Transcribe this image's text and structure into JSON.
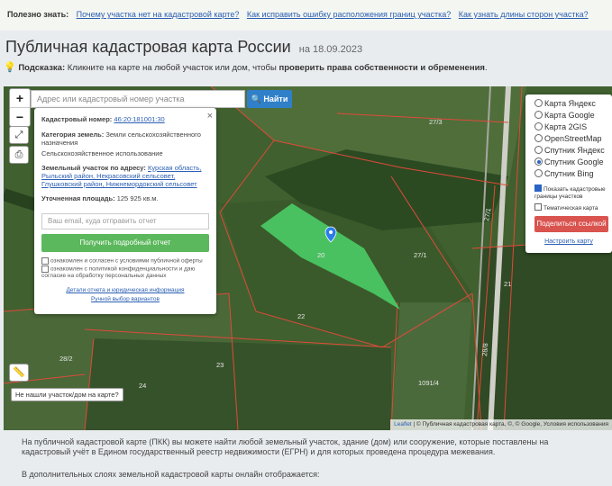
{
  "topbar": {
    "label": "Полезно знать:",
    "links": [
      "Почему участка нет на кадастровой карте?",
      "Как исправить ошибку расположения границ участка?",
      "Как узнать длины сторон участка?"
    ]
  },
  "page": {
    "title": "Публичная кадастровая карта России",
    "date": "на 18.09.2023"
  },
  "hint": {
    "label": "Подсказка:",
    "text": "Кликните на карте на любой участок или дом, чтобы",
    "bold": "проверить права собственности и обременения",
    "end": "."
  },
  "search": {
    "placeholder": "Адрес или кадастровый номер участка",
    "button": "Найти"
  },
  "zoom": {
    "plus": "+",
    "minus": "−"
  },
  "info": {
    "cad_label": "Кадастровый номер:",
    "cad_value": "46:20:181001:30",
    "cat_label": "Категория земель:",
    "cat_value": "Земли сельскохозяйственного назначения",
    "use_value": "Сельскохозяйственное использование",
    "addr_label": "Земельный участок по адресу:",
    "addr_value": "Курская область, Рыльский район, Некрасовский сельсовет, Глушковский район, Нижнемордокский сельсовет",
    "area_label": "Уточненная площадь:",
    "area_value": "125 925 кв.м.",
    "email_placeholder": "Ваш email, куда отправить отчет",
    "report_button": "Получить подробный отчет",
    "agree1": "ознакомлен и согласен с условиями публичной оферты",
    "agree2": "ознакомлен с политикой конфиденциальности и даю согласие на обработку персональных данных",
    "details_link": "Детали отчета и юридическая информация",
    "manual_link": "Ручной выбор вариантов",
    "close": "×"
  },
  "layers": {
    "options": [
      "Карта Яндекс",
      "Карта Google",
      "Карта 2GIS",
      "OpenStreetMap",
      "Спутник Яндекс",
      "Спутник Google",
      "Спутник Bing"
    ],
    "selected": "Спутник Google",
    "show_borders": "Показать кадастровые границы участков",
    "thematic": "Тематическая карта",
    "share": "Поделиться ссылкой",
    "configure": "Настроить карту"
  },
  "map": {
    "not_found": "Не нашли участок/дом на карте?",
    "attrib_leaflet": "Leaflet",
    "attrib_rest": "| © Публичная кадастровая карта, ©, © Google, Условия использования",
    "parcel_labels": [
      "27/3",
      "27/1",
      "27/1",
      "21",
      "22",
      "23",
      "24",
      "28/2",
      "1091/4",
      "28/8",
      "20"
    ]
  },
  "text": {
    "para1": "На публичной кадастровой карте (ПКК) вы можете найти любой земельный участок, здание (дом) или сооружение, которые поставлены на кадастровый учёт в Едином государственный реестр недвижимости (ЕГРН) и для которых проведена процедура межевания.",
    "para2": "В дополнительных слоях земельной кадастровой карты онлайн отображается:"
  }
}
